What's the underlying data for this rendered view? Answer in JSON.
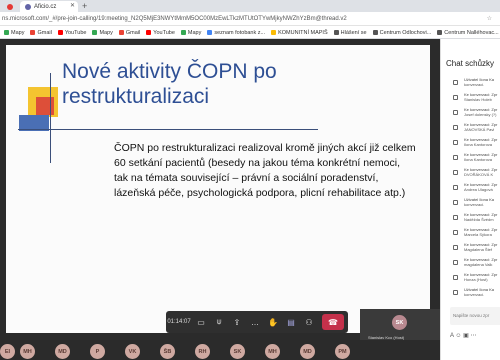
{
  "browser": {
    "tabs": [
      {
        "label": "",
        "active": false
      },
      {
        "label": "Aficio.cz",
        "active": true
      }
    ],
    "url": "ns.microsoft.com/_#/pre-join-calling/19:meeting_N2Q5MjE3NWYtMmM5OC00MzEwLTkzMTUtOTYwMjkyNWZhYzBm@thread.v2",
    "bookmarks": [
      {
        "label": "Mapy",
        "color": "#34a853"
      },
      {
        "label": "Gmail",
        "color": "#ea4335"
      },
      {
        "label": "YouTube",
        "color": "#ff0000"
      },
      {
        "label": "Mapy",
        "color": "#34a853"
      },
      {
        "label": "Gmail",
        "color": "#ea4335"
      },
      {
        "label": "YouTube",
        "color": "#ff0000"
      },
      {
        "label": "Mapy",
        "color": "#34a853"
      },
      {
        "label": "seznam fotobank z...",
        "color": "#4285f4"
      },
      {
        "label": "KOMUNITNÍ MAPIŠ",
        "color": "#fbbc05"
      },
      {
        "label": "Hlášení se",
        "color": "#555555"
      },
      {
        "label": "Centrum Odlochovi...",
        "color": "#555555"
      },
      {
        "label": "Centrum Nalléhovac...",
        "color": "#555555"
      }
    ]
  },
  "slide": {
    "title_line1": "Nové aktivity ČOPN po",
    "title_line2": "restrukturalizaci",
    "body": "ČOPN po restrukturalizaci realizoval kromě jiných akcí již celkem 60 setkání pacientů (besedy na jakou téma konkrétní nemoci, tak na témata související – právní a sociální poradenství, lázeňská péče, psychologická podpora, plicní rehabilitace atp.)"
  },
  "controls": {
    "timer": "01:14:07",
    "buttons": [
      {
        "name": "camera-button",
        "glyph": "▭"
      },
      {
        "name": "mic-button",
        "glyph": "⍦"
      },
      {
        "name": "share-button",
        "glyph": "⇪"
      },
      {
        "name": "more-button",
        "glyph": "…"
      },
      {
        "name": "raise-hand-button",
        "glyph": "✋"
      },
      {
        "name": "chat-button",
        "glyph": "▤"
      },
      {
        "name": "participants-button",
        "glyph": "⚇"
      }
    ],
    "hangup_glyph": "☎"
  },
  "participants": [
    "EI",
    "MH",
    "MD",
    "P",
    "VK",
    "ŠB",
    "RH",
    "SK",
    "MH",
    "MD",
    "PM"
  ],
  "self": {
    "initials": "SK",
    "name": "Stanislav Kco (Host)"
  },
  "chat": {
    "title": "Chat schůzky",
    "messages": [
      {
        "l1": "Uživatel Ilona Ka",
        "l2": "konverzaci."
      },
      {
        "l1": "Ke konverzaci: Zpr",
        "l2": "Stanislav Holeb"
      },
      {
        "l1": "Ke konverzaci: Zpr",
        "l2": "Josef dolensky (?)"
      },
      {
        "l1": "Ke konverzaci: Zpr",
        "l2": "JANOVSKÁ Pavl"
      },
      {
        "l1": "Ke konverzaci: Zpr",
        "l2": "Ilona Kantorova"
      },
      {
        "l1": "Ke konverzaci: Zpr",
        "l2": "Ilona Kantorova"
      },
      {
        "l1": "Ke konverzaci: Zpr",
        "l2": "DVOŘÁKOVÁ K"
      },
      {
        "l1": "Ke konverzaci: Zpr",
        "l2": "Andrea Ulagová"
      },
      {
        "l1": "Uživatel Ilona Ka",
        "l2": "konverzaci."
      },
      {
        "l1": "Ke konverzaci: Zpr",
        "l2": "Naděžda Švédm"
      },
      {
        "l1": "Ke konverzaci: Zpr",
        "l2": "Marcela Sýkora"
      },
      {
        "l1": "Ke konverzaci: Zpr",
        "l2": "Magdalena Štef"
      },
      {
        "l1": "Ke konverzaci: Zpr",
        "l2": "magdalena Valk"
      },
      {
        "l1": "Ke konverzaci: Zpr",
        "l2": "Honza (Host)"
      },
      {
        "l1": "Uživatel Ilona Ka",
        "l2": "konverzaci."
      }
    ],
    "compose_placeholder": "Napište novou zpr",
    "tools": "A ☺ ▣ ⋯"
  }
}
